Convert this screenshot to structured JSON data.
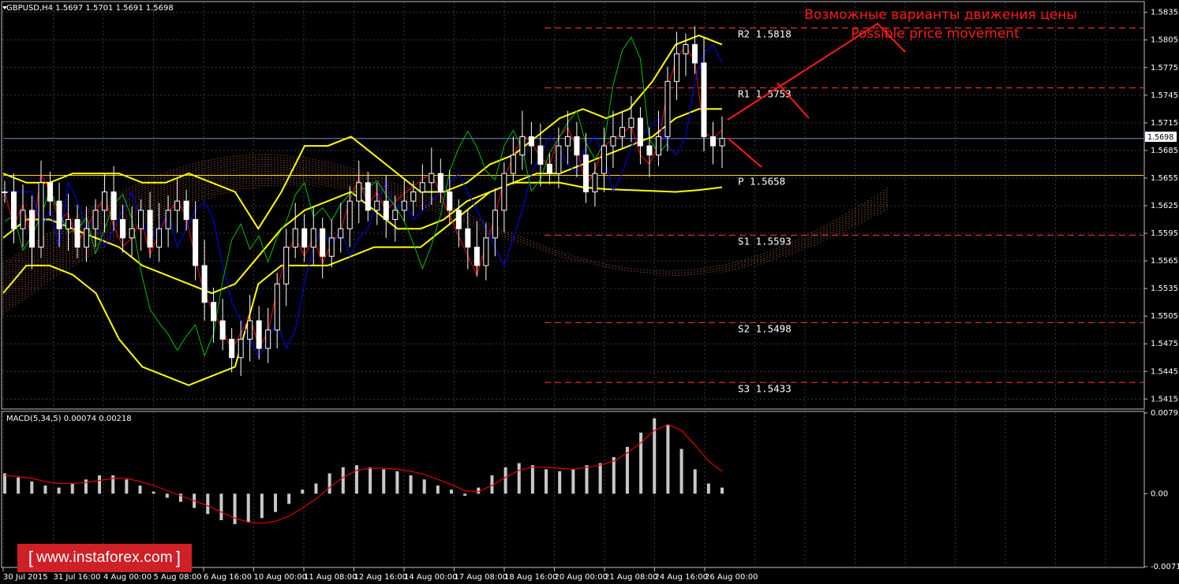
{
  "symbol_header": "GBPUSD,H4  1.5697 1.5701 1.5691 1.5698",
  "macd_header": "MACD(5,34,5) 0.00074 0.00218",
  "annotation": {
    "line1": "Возможные варианты движения цены",
    "line2": "Possible price movement"
  },
  "logo": {
    "bracket_open": "[",
    "text": "www.instaforex.com",
    "bracket_close": "]"
  },
  "current_price_label": "1.5698",
  "colors": {
    "background": "#000000",
    "grid": "#3a3a3a",
    "candle": "#ffffff",
    "bollinger": "#ffff00",
    "tenkan": "#ff0000",
    "kijun": "#0000ff",
    "chikou": "#00c000",
    "cloud": "#ff8c55",
    "levels": "#ff3b3b",
    "pivot": "#ffd700",
    "annotation": "#ff1a1a",
    "macd_hist": "#c8c8c8",
    "macd_signal": "#e00000"
  },
  "chart_data": [
    {
      "type": "candlestick",
      "title": "GBPUSD,H4",
      "y_axis_ticks": [
        "1.5835",
        "1.5805",
        "1.5775",
        "1.5745",
        "1.5715",
        "1.5685",
        "1.5655",
        "1.5625",
        "1.5595",
        "1.5565",
        "1.5535",
        "1.5505",
        "1.5475",
        "1.5445",
        "1.5415"
      ],
      "ylim": [
        1.5405,
        1.5845
      ],
      "x_axis_ticks": [
        "30 Jul 2015",
        "31 Jul 16:00",
        "4 Aug 00:00",
        "5 Aug 08:00",
        "6 Aug 16:00",
        "10 Aug 00:00",
        "11 Aug 08:00",
        "12 Aug 16:00",
        "14 Aug 00:00",
        "17 Aug 08:00",
        "18 Aug 16:00",
        "20 Aug 00:00",
        "21 Aug 08:00",
        "24 Aug 16:00",
        "26 Aug 00:00"
      ],
      "current_price": 1.5698,
      "ohlc_close_path": [
        1.564,
        1.56,
        1.562,
        1.558,
        1.565,
        1.563,
        1.56,
        1.561,
        1.558,
        1.56,
        1.562,
        1.564,
        1.561,
        1.559,
        1.56,
        1.562,
        1.558,
        1.56,
        1.562,
        1.563,
        1.561,
        1.556,
        1.552,
        1.55,
        1.548,
        1.546,
        1.548,
        1.55,
        1.547,
        1.549,
        1.554,
        1.558,
        1.56,
        1.558,
        1.56,
        1.557,
        1.559,
        1.56,
        1.563,
        1.565,
        1.562,
        1.563,
        1.561,
        1.562,
        1.563,
        1.564,
        1.565,
        1.566,
        1.564,
        1.562,
        1.56,
        1.558,
        1.556,
        1.559,
        1.562,
        1.566,
        1.568,
        1.57,
        1.569,
        1.567,
        1.566,
        1.569,
        1.57,
        1.568,
        1.564,
        1.566,
        1.569,
        1.57,
        1.571,
        1.572,
        1.569,
        1.568,
        1.57,
        1.576,
        1.579,
        1.58,
        1.578,
        1.57,
        1.569,
        1.5698
      ],
      "levels": [
        {
          "name": "R2",
          "label": "R2  1.5818",
          "value": 1.5818
        },
        {
          "name": "R1",
          "label": "R1  1.5753",
          "value": 1.5753
        },
        {
          "name": "P",
          "label": "P  1.5658",
          "value": 1.5658
        },
        {
          "name": "S1",
          "label": "S1  1.5593",
          "value": 1.5593
        },
        {
          "name": "S2",
          "label": "S2  1.5498",
          "value": 1.5498
        },
        {
          "name": "S3",
          "label": "S3  1.5433",
          "value": 1.5433
        }
      ],
      "bollinger_upper": [
        1.566,
        1.565,
        1.565,
        1.566,
        1.566,
        1.566,
        1.565,
        1.565,
        1.566,
        1.565,
        1.564,
        1.56,
        1.564,
        1.569,
        1.569,
        1.57,
        1.568,
        1.566,
        1.564,
        1.564,
        1.565,
        1.567,
        1.568,
        1.57,
        1.572,
        1.573,
        1.572,
        1.573,
        1.576,
        1.58,
        1.581,
        1.58
      ],
      "bollinger_middle": [
        1.559,
        1.561,
        1.561,
        1.56,
        1.559,
        1.558,
        1.556,
        1.555,
        1.554,
        1.553,
        1.554,
        1.557,
        1.56,
        1.562,
        1.563,
        1.564,
        1.562,
        1.56,
        1.56,
        1.561,
        1.563,
        1.564,
        1.565,
        1.566,
        1.566,
        1.567,
        1.568,
        1.569,
        1.57,
        1.572,
        1.573,
        1.573
      ],
      "bollinger_lower": [
        1.553,
        1.556,
        1.556,
        1.555,
        1.553,
        1.548,
        1.545,
        1.544,
        1.543,
        1.544,
        1.545,
        1.554,
        1.556,
        1.556,
        1.556,
        1.557,
        1.558,
        1.558,
        1.558,
        1.56,
        1.562,
        1.564,
        1.565,
        1.565,
        1.565,
        1.5645,
        1.5643,
        1.5642,
        1.5641,
        1.564,
        1.5642,
        1.5645
      ]
    },
    {
      "type": "bar",
      "title": "MACD(5,34,5)",
      "main_value": 0.00074,
      "signal_value": 0.00218,
      "y_axis_ticks": [
        "0.00793",
        "0.00",
        "-0.00717"
      ],
      "ylim": [
        -0.00717,
        0.00793
      ],
      "histogram": [
        0.002,
        0.0016,
        0.0012,
        0.0008,
        0.0006,
        0.001,
        0.0014,
        0.0018,
        0.0018,
        0.0014,
        0.0008,
        0.0002,
        -0.0004,
        -0.0008,
        -0.0014,
        -0.002,
        -0.0026,
        -0.003,
        -0.0028,
        -0.0024,
        -0.0018,
        -0.001,
        0.0004,
        0.001,
        0.002,
        0.0026,
        0.0028,
        0.0026,
        0.0024,
        0.0022,
        0.0018,
        0.0014,
        0.0008,
        0.0004,
        -0.0002,
        0.0006,
        0.0018,
        0.0026,
        0.003,
        0.0028,
        0.0024,
        0.0022,
        0.0024,
        0.0028,
        0.003,
        0.0036,
        0.0046,
        0.006,
        0.0074,
        0.0068,
        0.0044,
        0.0024,
        0.001,
        0.0006
      ],
      "signal": [
        0.0018,
        0.0017,
        0.0015,
        0.0012,
        0.001,
        0.001,
        0.0011,
        0.0013,
        0.0015,
        0.0015,
        0.0012,
        0.0008,
        0.0003,
        -0.0002,
        -0.0007,
        -0.0012,
        -0.0018,
        -0.0024,
        -0.0028,
        -0.0029,
        -0.0027,
        -0.0022,
        -0.0014,
        -0.0005,
        0.0006,
        0.0016,
        0.0023,
        0.0025,
        0.0025,
        0.0024,
        0.0022,
        0.0019,
        0.0014,
        0.0009,
        0.0003,
        0.0002,
        0.0008,
        0.0016,
        0.0023,
        0.0026,
        0.0026,
        0.0025,
        0.0024,
        0.0026,
        0.0028,
        0.0032,
        0.004,
        0.005,
        0.0062,
        0.0068,
        0.0062,
        0.0048,
        0.0032,
        0.0022
      ]
    }
  ]
}
